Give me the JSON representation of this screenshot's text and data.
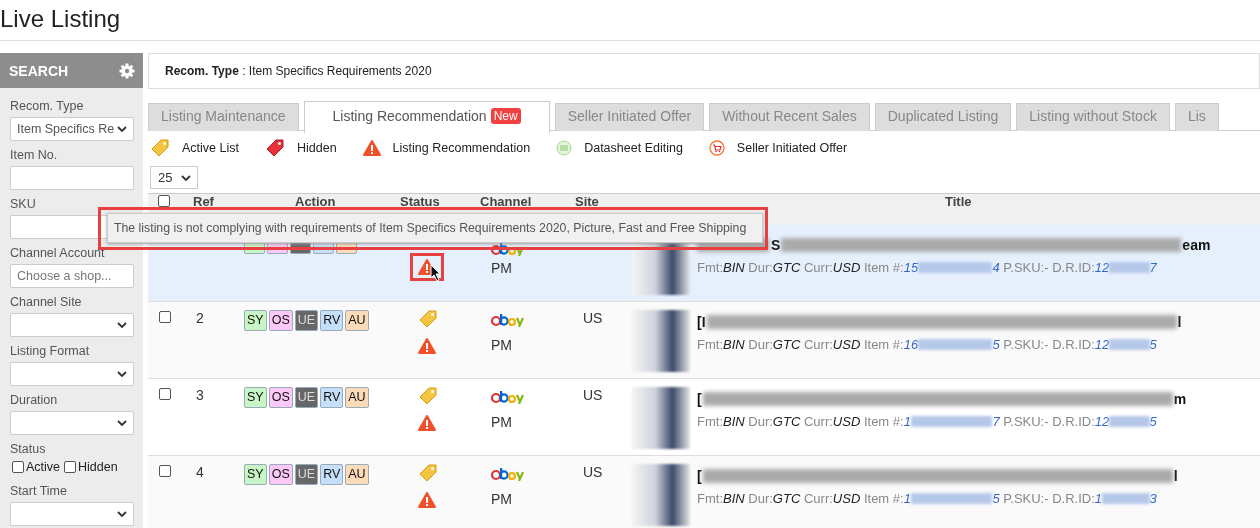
{
  "page_title": "Live Listing",
  "sidebar": {
    "header": "SEARCH",
    "fields": [
      {
        "kind": "select",
        "label": "Recom. Type",
        "value": "Item Specifics Re"
      },
      {
        "kind": "input",
        "label": "Item No."
      },
      {
        "kind": "input",
        "label": "SKU"
      },
      {
        "kind": "input",
        "label": "Channel Account",
        "placeholder": "Choose a shop..."
      },
      {
        "kind": "select",
        "label": "Channel Site"
      },
      {
        "kind": "select",
        "label": "Listing Format"
      },
      {
        "kind": "select",
        "label": "Duration"
      },
      {
        "kind": "checks",
        "label": "Status",
        "options": [
          {
            "label": "Active",
            "checked": false
          },
          {
            "label": "Hidden",
            "checked": false
          }
        ]
      },
      {
        "kind": "select",
        "label": "Start Time"
      }
    ]
  },
  "recom_bar": {
    "label": "Recom. Type",
    "value": " : Item Specifics Requirements 2020"
  },
  "tabs": [
    {
      "label": "Listing Maintenance",
      "selected": false
    },
    {
      "label": "Listing Recommendation",
      "selected": true,
      "badge": "New"
    },
    {
      "label": "Seller Initiated Offer",
      "selected": false
    },
    {
      "label": "Without Recent Sales",
      "selected": false
    },
    {
      "label": "Duplicated Listing",
      "selected": false
    },
    {
      "label": "Listing without Stock",
      "selected": false
    },
    {
      "label": "Lis",
      "selected": false
    }
  ],
  "legend": [
    {
      "kind": "active",
      "label": "Active List"
    },
    {
      "kind": "hidden",
      "label": "Hidden"
    },
    {
      "kind": "recommendation",
      "label": "Listing Recommendation"
    },
    {
      "kind": "datasheet",
      "label": "Datasheet Editing"
    },
    {
      "kind": "offer",
      "label": "Seller Initiated Offer"
    }
  ],
  "page_size": "25",
  "table": {
    "select_all": {
      "checked": false
    },
    "columns": [
      "Ref",
      "Action",
      "Status",
      "Channel",
      "Site",
      "Title"
    ],
    "rows": [
      {
        "selected": true,
        "status_icons": [
          {
            "kind": "recommendation"
          }
        ],
        "highlighted": true,
        "channel": "PM",
        "title_covered": true,
        "title_fragment": "S",
        "title_end": "eam",
        "fmt_label": "Fmt:",
        "fmt": "BIN",
        "dur_label": "Dur:",
        "dur": "GTC",
        "curr_label": "Curr:",
        "curr": "USD",
        "item_label": "Item #:",
        "item_start": "15",
        "item_end": "4",
        "psku_label": "P.SKU:",
        "psku": "-",
        "drid_label": "D.R.ID:",
        "drid_start": "12",
        "drid_end": "7",
        "badges": [
          {
            "color": "#c8f7c5"
          },
          {
            "color": "#fbc8f7"
          },
          {
            "color": "#676767"
          },
          {
            "color": "#c6e0fb"
          },
          {
            "color": "#fcdcb8"
          }
        ]
      },
      {
        "selected": false,
        "checked": false,
        "ref": "2",
        "site": "US",
        "status_icons": [
          {
            "kind": "active"
          },
          {
            "kind": "recommendation"
          }
        ],
        "highlighted": false,
        "channel": "PM",
        "title_start": "[I",
        "title_end": "l",
        "fmt_label": "Fmt:",
        "fmt": "BIN",
        "dur_label": "Dur:",
        "dur": "GTC",
        "curr_label": "Curr:",
        "curr": "USD",
        "item_label": "Item #:",
        "item_start": "16",
        "item_end": "5",
        "psku_label": "P.SKU:",
        "psku": "-",
        "drid_label": "D.R.ID:",
        "drid_start": "12",
        "drid_end": "5",
        "badges": [
          {
            "label": "SY",
            "color": "#c8f7c5"
          },
          {
            "label": "OS",
            "color": "#fbc8f7"
          },
          {
            "label": "UE",
            "color": "#676767"
          },
          {
            "label": "RV",
            "color": "#c6e0fb"
          },
          {
            "label": "AU",
            "color": "#fcdcb8"
          }
        ]
      },
      {
        "selected": false,
        "checked": false,
        "ref": "3",
        "site": "US",
        "status_icons": [
          {
            "kind": "active"
          },
          {
            "kind": "recommendation"
          }
        ],
        "highlighted": false,
        "channel": "PM",
        "title_start": "[",
        "title_end": "m",
        "fmt_label": "Fmt:",
        "fmt": "BIN",
        "dur_label": "Dur:",
        "dur": "GTC",
        "curr_label": "Curr:",
        "curr": "USD",
        "item_label": "Item #:",
        "item_start": "1",
        "item_end": "7",
        "psku_label": "P.SKU:",
        "psku": "-",
        "drid_label": "D.R.ID:",
        "drid_start": "12",
        "drid_end": "5",
        "badges": [
          {
            "label": "SY",
            "color": "#c8f7c5"
          },
          {
            "label": "OS",
            "color": "#fbc8f7"
          },
          {
            "label": "UE",
            "color": "#676767"
          },
          {
            "label": "RV",
            "color": "#c6e0fb"
          },
          {
            "label": "AU",
            "color": "#fcdcb8"
          }
        ]
      },
      {
        "selected": false,
        "checked": false,
        "ref": "4",
        "site": "US",
        "status_icons": [
          {
            "kind": "active"
          },
          {
            "kind": "recommendation"
          }
        ],
        "highlighted": false,
        "channel": "PM",
        "title_start": "[",
        "title_end": "l",
        "fmt_label": "Fmt:",
        "fmt": "BIN",
        "dur_label": "Dur:",
        "dur": "GTC",
        "curr_label": "Curr:",
        "curr": "USD",
        "item_label": "Item #:",
        "item_start": "1",
        "item_end": "5",
        "psku_label": "P.SKU:",
        "psku": "-",
        "drid_label": "D.R.ID:",
        "drid_start": "1",
        "drid_end": "3",
        "badges": [
          {
            "label": "SY",
            "color": "#c8f7c5"
          },
          {
            "label": "OS",
            "color": "#fbc8f7"
          },
          {
            "label": "UE",
            "color": "#676767"
          },
          {
            "label": "RV",
            "color": "#c6e0fb"
          },
          {
            "label": "AU",
            "color": "#fcdcb8"
          }
        ]
      }
    ]
  },
  "tooltip": {
    "text": "The listing is not complying with requirements of Item Specifics Requirements 2020, Picture, Fast and Free Shipping"
  }
}
